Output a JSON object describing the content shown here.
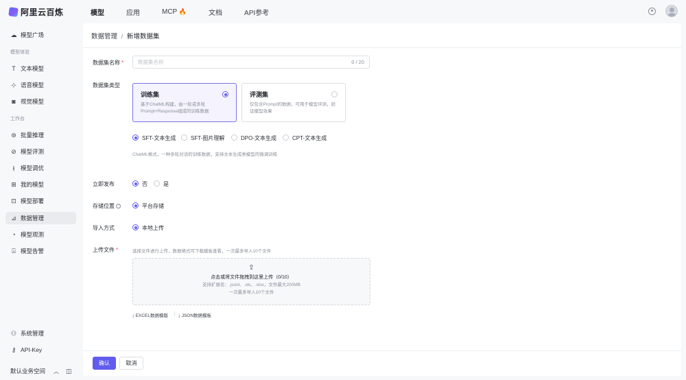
{
  "app": {
    "title": "阿里云百炼"
  },
  "topnav": [
    {
      "label": "模型"
    },
    {
      "label": "应用"
    },
    {
      "label": "MCP"
    },
    {
      "label": "文档"
    },
    {
      "label": "API参考"
    }
  ],
  "topnav_mcp_icon": "🔥",
  "sidebar": {
    "home": {
      "label": "模型广场",
      "icon": "cloud-icon"
    },
    "group1": "模型体验",
    "exp": [
      {
        "label": "文本模型",
        "icon": "text-icon"
      },
      {
        "label": "语音模型",
        "icon": "audio-icon"
      },
      {
        "label": "视觉模型",
        "icon": "camera-icon"
      }
    ],
    "group2": "工作台",
    "work": [
      {
        "label": "批量推理",
        "icon": "batch-icon"
      },
      {
        "label": "模型评测",
        "icon": "evaluate-icon"
      },
      {
        "label": "模型调优",
        "icon": "tune-icon"
      },
      {
        "label": "我的模型",
        "icon": "grid-icon"
      },
      {
        "label": "模型部署",
        "icon": "deploy-icon"
      },
      {
        "label": "数据管理",
        "icon": "chart-icon"
      },
      {
        "label": "模型观测",
        "icon": "pie-icon"
      },
      {
        "label": "模型告警",
        "icon": "alarm-icon"
      }
    ],
    "system": {
      "label": "系统管理",
      "icon": "user-icon"
    },
    "apikey": {
      "label": "API-Key",
      "icon": "key-icon"
    },
    "workspace": {
      "label": "默认业务空间"
    }
  },
  "breadcrumb": {
    "parent": "数据管理",
    "sep": "/",
    "current": "新增数据集"
  },
  "form": {
    "name_label": "数据集名称",
    "name_placeholder": "数据集名称",
    "name_counter": "0 / 20",
    "type_label": "数据集类型",
    "train": {
      "title": "训练集",
      "desc": "基于ChatML构建，由一轮或多轮Prompt+Response组成的训练数据"
    },
    "eval": {
      "title": "评测集",
      "desc": "仅包含Prompt的数据，可用于模型评测，验证模型效果"
    },
    "subtypes": [
      "SFT-文本生成",
      "SFT-图片理解",
      "DPO-文本生成",
      "CPT-文本生成"
    ],
    "subtype_hint": "ChatML格式，一种多轮对话的训练数据，支持文本生成类模型的微调训练",
    "publish_label": "立即发布",
    "publish_opts": [
      "否",
      "是"
    ],
    "storage_label": "存储位置",
    "storage_opt": "平台存储",
    "import_label": "导入方式",
    "import_opt": "本地上传",
    "upload_label": "上传文件",
    "upload_hint": "选择文件进行上传，数据格式可下载模板查看，一次最多导入10个文件",
    "upload_main": "点击或将文件拖拽到这里上传（0/10）",
    "upload_sub1": "支持扩展名：.jsonl、.xls、.xlsx，文件最大200MB",
    "upload_sub2": "一次最多导入10个文件",
    "tmpl_excel": "EXCEL数据模版",
    "tmpl_sep": "|",
    "tmpl_json": "JSON数据模板"
  },
  "footer": {
    "confirm": "确认",
    "cancel": "取消"
  },
  "colors": {
    "accent": "#615ced"
  }
}
